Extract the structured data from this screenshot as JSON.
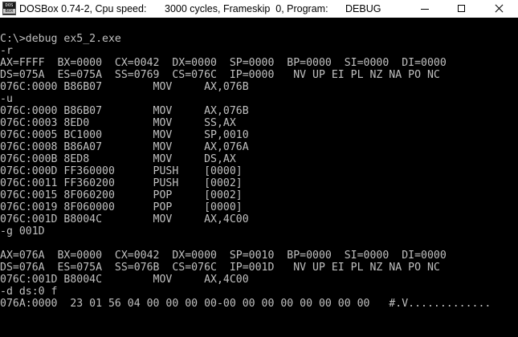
{
  "window": {
    "icon_text_top": "DOS",
    "icon_text_bottom": "BOX",
    "title_app": "DOSBox 0.74-2, Cpu speed:",
    "title_cycles": "3000 cycles, Frameskip  0, Program:",
    "title_program": "DEBUG",
    "controls": {
      "minimize": "minimize-icon",
      "maximize": "maximize-icon",
      "close": "close-icon"
    },
    "title_bg_color": "#ffffff",
    "screen_bg_color": "#000000",
    "text_color": "#c0c0c0"
  },
  "console": {
    "lines": [
      "",
      "C:\\>debug ex5_2.exe",
      "-r",
      "AX=FFFF  BX=0000  CX=0042  DX=0000  SP=0000  BP=0000  SI=0000  DI=0000",
      "DS=075A  ES=075A  SS=0769  CS=076C  IP=0000   NV UP EI PL NZ NA PO NC",
      "076C:0000 B86B07        MOV     AX,076B",
      "-u",
      "076C:0000 B86B07        MOV     AX,076B",
      "076C:0003 8ED0          MOV     SS,AX",
      "076C:0005 BC1000        MOV     SP,0010",
      "076C:0008 B86A07        MOV     AX,076A",
      "076C:000B 8ED8          MOV     DS,AX",
      "076C:000D FF360000      PUSH    [0000]",
      "076C:0011 FF360200      PUSH    [0002]",
      "076C:0015 8F060200      POP     [0002]",
      "076C:0019 8F060000      POP     [0000]",
      "076C:001D B8004C        MOV     AX,4C00",
      "-g 001D",
      "",
      "AX=076A  BX=0000  CX=0042  DX=0000  SP=0010  BP=0000  SI=0000  DI=0000",
      "DS=076A  ES=075A  SS=076B  CS=076C  IP=001D   NV UP EI PL NZ NA PO NC",
      "076C:001D B8004C        MOV     AX,4C00",
      "-d ds:0 f",
      "076A:0000  23 01 56 04 00 00 00 00-00 00 00 00 00 00 00 00   #.V............."
    ]
  }
}
